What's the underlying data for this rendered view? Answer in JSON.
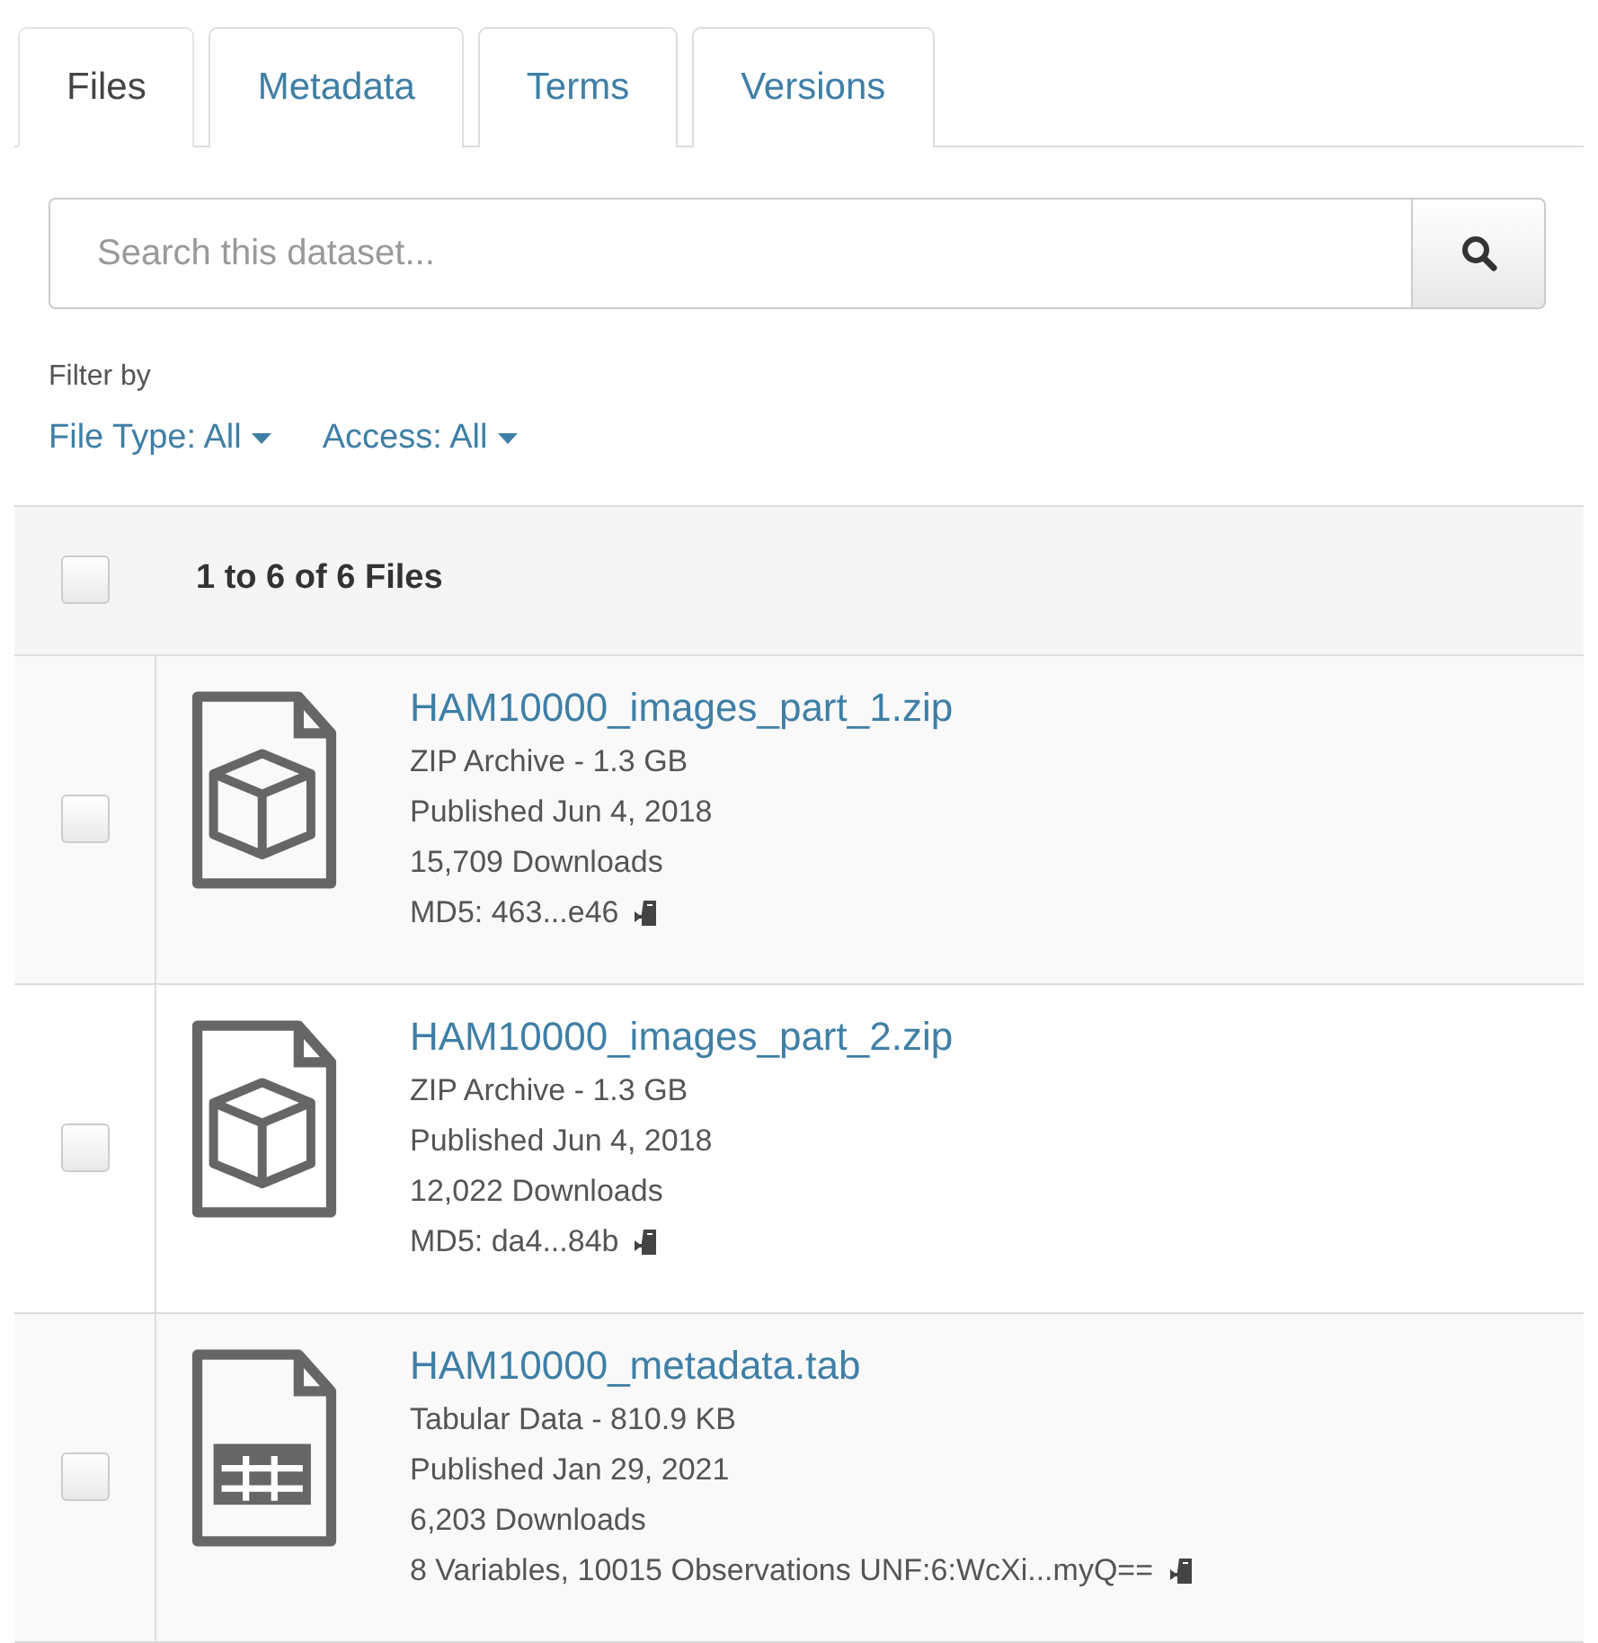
{
  "tabs": [
    {
      "label": "Files",
      "selected": true
    },
    {
      "label": "Metadata",
      "selected": false
    },
    {
      "label": "Terms",
      "selected": false
    },
    {
      "label": "Versions",
      "selected": false
    }
  ],
  "search": {
    "placeholder": "Search this dataset..."
  },
  "filter": {
    "label": "Filter by",
    "options": [
      "File Type: All",
      "Access: All"
    ]
  },
  "table": {
    "select_all": {
      "checked": false
    },
    "title": "1 to 6 of 6 Files",
    "files": [
      {
        "kind": "archive",
        "checked": false,
        "name": "HAM10000_images_part_1.zip",
        "details": [
          "ZIP Archive - 1.3 GB",
          "Published Jun 4, 2018",
          "15,709 Downloads"
        ],
        "checksum": "MD5: 463...e46"
      },
      {
        "kind": "archive",
        "checked": false,
        "name": "HAM10000_images_part_2.zip",
        "details": [
          "ZIP Archive - 1.3 GB",
          "Published Jun 4, 2018",
          "12,022 Downloads"
        ],
        "checksum": "MD5: da4...84b"
      },
      {
        "kind": "tabular",
        "checked": false,
        "name": "HAM10000_metadata.tab",
        "details": [
          "Tabular Data - 810.9 KB",
          "Published Jan 29, 2021",
          "6,203 Downloads"
        ],
        "checksum": "8 Variables, 10015 Observations UNF:6:WcXi...myQ=="
      }
    ]
  }
}
